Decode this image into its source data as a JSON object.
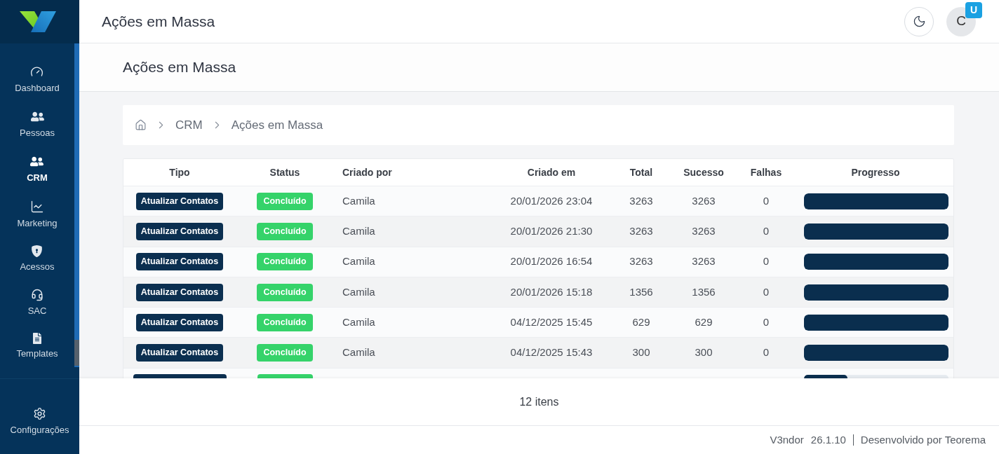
{
  "sidebar": {
    "items": [
      {
        "label": "Dashboard",
        "selected": false
      },
      {
        "label": "Pessoas",
        "selected": false
      },
      {
        "label": "CRM",
        "selected": true
      },
      {
        "label": "Marketing",
        "selected": false
      },
      {
        "label": "Acessos",
        "selected": false
      },
      {
        "label": "SAC",
        "selected": false
      },
      {
        "label": "Templates",
        "selected": false
      }
    ],
    "settings": {
      "label": "Configurações",
      "selected": false
    }
  },
  "header": {
    "title": "Ações em Massa",
    "avatar": {
      "initial": "C",
      "badge": "U"
    }
  },
  "page_title": "Ações em Massa",
  "breadcrumb": [
    {
      "label": "CRM"
    },
    {
      "label": "Ações em Massa"
    }
  ],
  "table": {
    "columns": [
      "Tipo",
      "Status",
      "Criado por",
      "Criado em",
      "Total",
      "Sucesso",
      "Falhas",
      "Progresso"
    ],
    "rows": [
      {
        "kind": "full",
        "tipo": "Atualizar Contatos",
        "status": "Concluído",
        "criado_por": "Camila",
        "criado_em": "20/01/2026 23:04",
        "total": "3263",
        "sucesso": "3263",
        "falhas": "0",
        "progress": {
          "level": 1
        }
      },
      {
        "kind": "full",
        "tipo": "Atualizar Contatos",
        "status": "Concluído",
        "criado_por": "Camila",
        "criado_em": "20/01/2026 21:30",
        "total": "3263",
        "sucesso": "3263",
        "falhas": "0",
        "progress": {
          "level": 1
        }
      },
      {
        "kind": "full",
        "tipo": "Atualizar Contatos",
        "status": "Concluído",
        "criado_por": "Camila",
        "criado_em": "20/01/2026 16:54",
        "total": "3263",
        "sucesso": "3263",
        "falhas": "0",
        "progress": {
          "level": 1
        }
      },
      {
        "kind": "full",
        "tipo": "Atualizar Contatos",
        "status": "Concluído",
        "criado_por": "Camila",
        "criado_em": "20/01/2026 15:18",
        "total": "1356",
        "sucesso": "1356",
        "falhas": "0",
        "progress": {
          "level": 1
        }
      },
      {
        "kind": "full",
        "tipo": "Atualizar Contatos",
        "status": "Concluído",
        "criado_por": "Camila",
        "criado_em": "04/12/2025 15:45",
        "total": "629",
        "sucesso": "629",
        "falhas": "0",
        "progress": {
          "level": 1
        }
      },
      {
        "kind": "full",
        "tipo": "Atualizar Contatos",
        "status": "Concluído",
        "criado_por": "Camila",
        "criado_em": "04/12/2025 15:43",
        "total": "300",
        "sucesso": "300",
        "falhas": "0",
        "progress": {
          "level": 1
        }
      },
      {
        "kind": "partial",
        "progress": {
          "level": 0.3
        }
      }
    ]
  },
  "pagination": {
    "count": "12 itens"
  },
  "footer": {
    "app": "V3ndor",
    "version": "26.1.10",
    "credit": "Desenvolvido por Teorema"
  }
}
